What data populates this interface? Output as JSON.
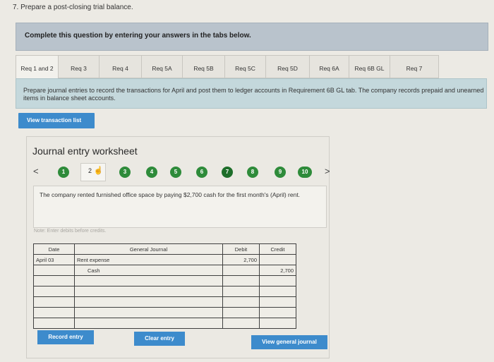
{
  "question": {
    "title": "7. Prepare a post-closing trial balance."
  },
  "instruction_banner": "Complete this question by entering your answers in the tabs below.",
  "tabs": [
    {
      "label": "Req 1 and 2"
    },
    {
      "label": "Req 3"
    },
    {
      "label": "Req 4"
    },
    {
      "label": "Req 5A"
    },
    {
      "label": "Req 5B"
    },
    {
      "label": "Req 5C"
    },
    {
      "label": "Req 5D"
    },
    {
      "label": "Req 6A"
    },
    {
      "label": "Req 6B GL"
    },
    {
      "label": "Req 7"
    }
  ],
  "requirement_text": "Prepare journal entries to record the transactions for April and post them to ledger accounts in Requirement 6B GL tab. The company records prepaid and unearned items in balance sheet accounts.",
  "view_transaction_list_label": "View transaction list",
  "worksheet": {
    "title": "Journal entry worksheet",
    "prev_arrow": "<",
    "next_arrow": ">",
    "steps": [
      "1",
      "2",
      "3",
      "4",
      "5",
      "6",
      "7",
      "8",
      "9",
      "10"
    ],
    "current_step": 2,
    "transaction_text": "The company rented furnished office space by paying $2,700 cash for the first month's (April) rent.",
    "note": "Note: Enter debits before credits.",
    "journal": {
      "headers": [
        "Date",
        "General Journal",
        "Debit",
        "Credit"
      ],
      "rows": [
        {
          "date": "April 03",
          "account": "Rent expense",
          "debit": "2,700",
          "credit": ""
        },
        {
          "date": "",
          "account": "Cash",
          "debit": "",
          "credit": "2,700"
        },
        {
          "date": "",
          "account": "",
          "debit": "",
          "credit": ""
        },
        {
          "date": "",
          "account": "",
          "debit": "",
          "credit": ""
        },
        {
          "date": "",
          "account": "",
          "debit": "",
          "credit": ""
        },
        {
          "date": "",
          "account": "",
          "debit": "",
          "credit": ""
        },
        {
          "date": "",
          "account": "",
          "debit": "",
          "credit": ""
        }
      ]
    },
    "buttons": {
      "record": "Record entry",
      "clear": "Clear entry",
      "view_journal": "View general journal"
    }
  },
  "colors": {
    "button_blue": "#3d8bcc",
    "step_green": "#2e8b3a",
    "banner_gray": "#b9c3cc",
    "requirement_teal": "#c4d8dc"
  }
}
